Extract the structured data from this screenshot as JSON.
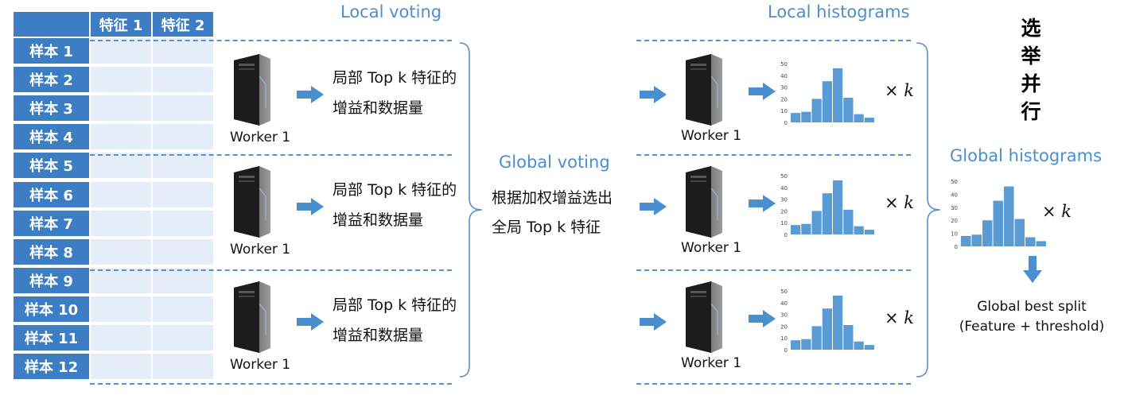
{
  "table": {
    "columns": [
      "特征 1",
      "特征 2"
    ],
    "rows": [
      "样本 1",
      "样本 2",
      "样本 3",
      "样本 4",
      "样本 5",
      "样本 6",
      "样本 7",
      "样本 8",
      "样本 9",
      "样本 10",
      "样本 11",
      "样本 12"
    ]
  },
  "local_voting": {
    "title": "Local voting",
    "workers": [
      {
        "label": "Worker 1",
        "line1": "局部 Top k 特征的",
        "line2": "增益和数据量"
      },
      {
        "label": "Worker 1",
        "line1": "局部 Top k 特征的",
        "line2": "增益和数据量"
      },
      {
        "label": "Worker 1",
        "line1": "局部 Top k 特征的",
        "line2": "增益和数据量"
      }
    ]
  },
  "global_voting": {
    "title": "Global voting",
    "line1": "根据加权增益选出",
    "line2": "全局 Top k 特征"
  },
  "local_histograms": {
    "title": "Local histograms",
    "workers": [
      "Worker 1",
      "Worker 1",
      "Worker 1"
    ],
    "multiplier": "×",
    "multiplier_var": "k"
  },
  "vertical_title": [
    "选",
    "举",
    "并",
    "行"
  ],
  "global_histograms": {
    "title": "Global histograms",
    "multiplier": "×",
    "multiplier_var": "k",
    "result_line1": "Global best split",
    "result_line2": "(Feature + threshold)"
  },
  "histogram": {
    "y_ticks": [
      "50",
      "40",
      "30",
      "20",
      "10",
      "0"
    ],
    "bar_values": [
      8,
      9,
      20,
      35,
      46,
      21,
      7,
      4
    ],
    "y_max": 50
  },
  "colors": {
    "accent": "#3d7dc4",
    "cell_fill": "#e5eef8",
    "title_blue": "#4a8fd0",
    "arrow": "#4a8fd0",
    "bar": "#5b9bd5"
  }
}
